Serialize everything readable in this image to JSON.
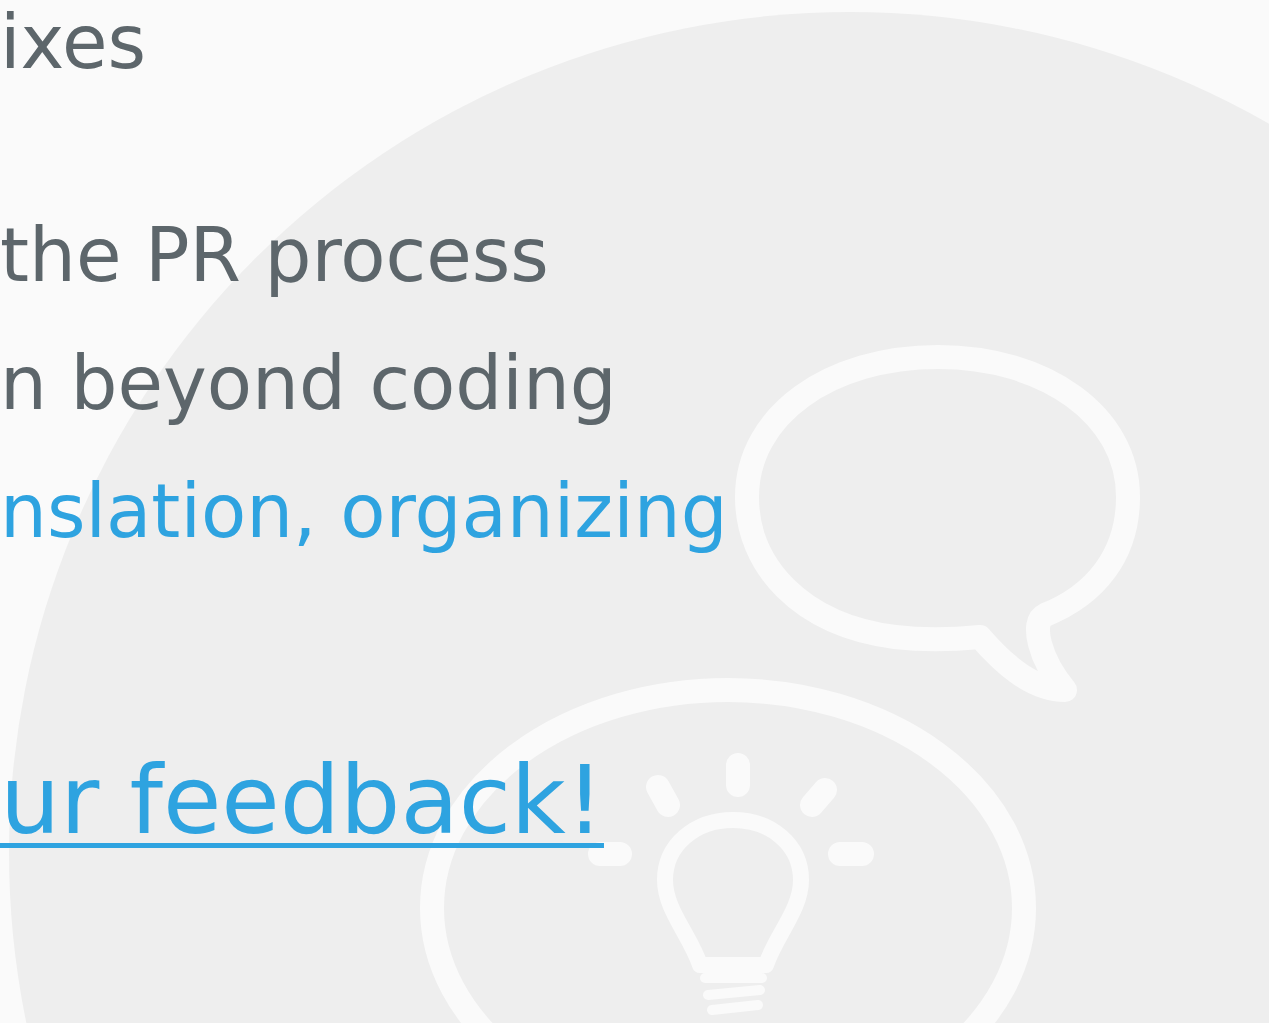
{
  "lines": [
    {
      "text": "ixes",
      "kind": "plain"
    },
    {
      "text": "the PR process",
      "kind": "plain"
    },
    {
      "text": "n beyond coding",
      "kind": "plain"
    },
    {
      "text": "nslation, organizing",
      "kind": "highlight"
    }
  ],
  "link": {
    "text": "ur feedback!"
  }
}
